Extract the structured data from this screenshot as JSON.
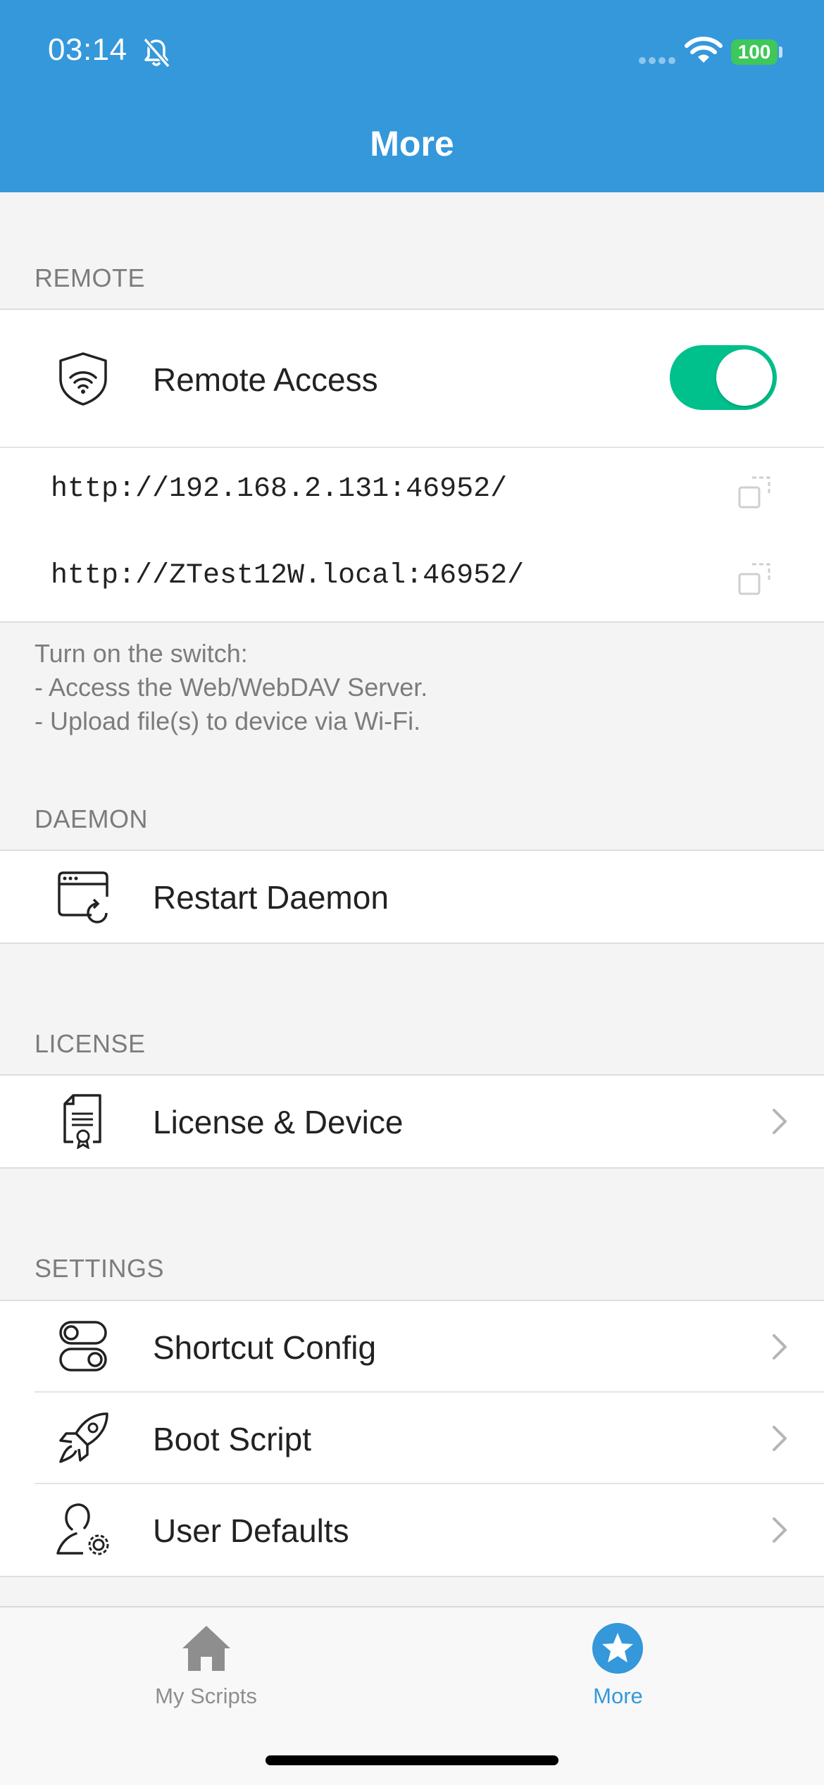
{
  "status_bar": {
    "time": "03:14",
    "battery": "100"
  },
  "header": {
    "title": "More"
  },
  "sections": {
    "remote": {
      "header": "REMOTE",
      "remote_access_label": "Remote Access",
      "remote_access_enabled": true,
      "urls": [
        "http://192.168.2.131:46952/",
        "http://ZTest12W.local:46952/"
      ],
      "footer": [
        "Turn on the switch:",
        "- Access the Web/WebDAV Server.",
        "- Upload file(s) to device via Wi-Fi."
      ]
    },
    "daemon": {
      "header": "DAEMON",
      "restart_label": "Restart Daemon"
    },
    "license": {
      "header": "LICENSE",
      "license_label": "License & Device"
    },
    "settings": {
      "header": "SETTINGS",
      "items": [
        {
          "label": "Shortcut Config",
          "icon": "toggles-icon"
        },
        {
          "label": "Boot Script",
          "icon": "rocket-icon"
        },
        {
          "label": "User Defaults",
          "icon": "user-gear-icon"
        }
      ]
    }
  },
  "tabbar": {
    "tabs": [
      {
        "label": "My Scripts",
        "icon": "home-icon",
        "selected": false
      },
      {
        "label": "More",
        "icon": "star-icon",
        "selected": true
      }
    ]
  },
  "colors": {
    "header_bg": "#3498db",
    "toggle_on": "#00c08b",
    "tab_selected": "#3498db",
    "tab_unselected": "#8e8e8e"
  }
}
